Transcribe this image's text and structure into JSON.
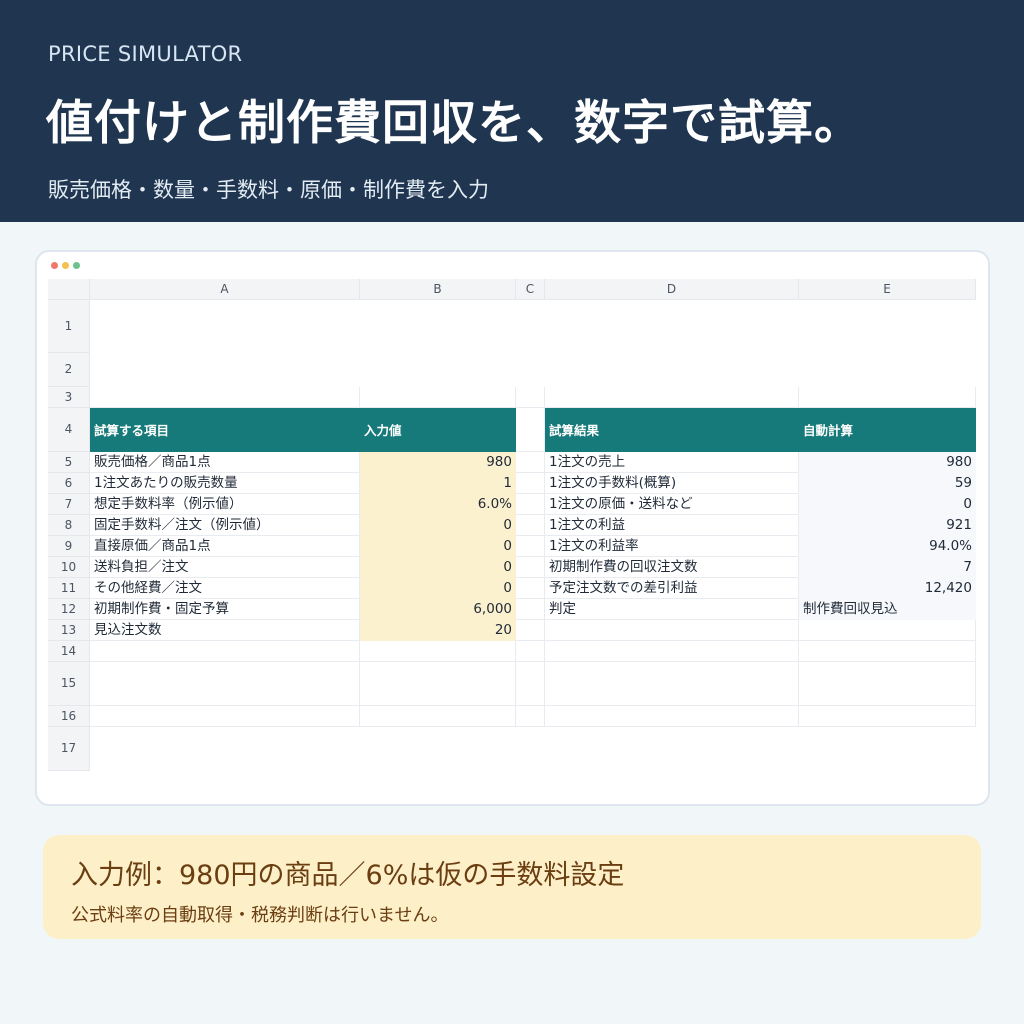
{
  "header": {
    "eyebrow": "PRICE SIMULATOR",
    "title": "値付けと制作費回収を、数字で試算。",
    "subtitle": "販売価格・数量・手数料・原価・制作費を入力"
  },
  "window": {
    "dot_colors": [
      "#f2776a",
      "#f4c04f",
      "#6cc18a"
    ]
  },
  "sheet": {
    "columns": [
      "A",
      "B",
      "C",
      "D",
      "E"
    ],
    "row_numbers": [
      "1",
      "2",
      "3",
      "4",
      "5",
      "6",
      "7",
      "8",
      "9",
      "10",
      "11",
      "12",
      "13",
      "14",
      "15",
      "16",
      "17"
    ],
    "headers": {
      "input_item": "試算する項目",
      "input_value": "入力値",
      "result_item": "試算結果",
      "result_value": "自動計算"
    },
    "inputs": [
      {
        "label": "販売価格／商品1点",
        "value": "980"
      },
      {
        "label": "1注文あたりの販売数量",
        "value": "1"
      },
      {
        "label": "想定手数料率（例示値）",
        "value": "6.0%"
      },
      {
        "label": "固定手数料／注文（例示値）",
        "value": "0"
      },
      {
        "label": "直接原価／商品1点",
        "value": "0"
      },
      {
        "label": "送料負担／注文",
        "value": "0"
      },
      {
        "label": "その他経費／注文",
        "value": "0"
      },
      {
        "label": "初期制作費・固定予算",
        "value": "6,000"
      },
      {
        "label": "見込注文数",
        "value": "20"
      }
    ],
    "results": [
      {
        "label": "1注文の売上",
        "value": "980"
      },
      {
        "label": "1注文の手数料(概算)",
        "value": "59"
      },
      {
        "label": "1注文の原価・送料など",
        "value": "0"
      },
      {
        "label": "1注文の利益",
        "value": "921"
      },
      {
        "label": "1注文の利益率",
        "value": "94.0%"
      },
      {
        "label": "初期制作費の回収注文数",
        "value": "7"
      },
      {
        "label": "予定注文数での差引利益",
        "value": "12,420"
      },
      {
        "label": "判定",
        "value": "制作費回収見込"
      }
    ],
    "colors": {
      "header_teal": "#167a7a",
      "input_fill": "#fcf1cf"
    }
  },
  "note": {
    "headline": "入力例：980円の商品／6%は仮の手数料設定",
    "subtext": "公式料率の自動取得・税務判断は行いません。"
  }
}
